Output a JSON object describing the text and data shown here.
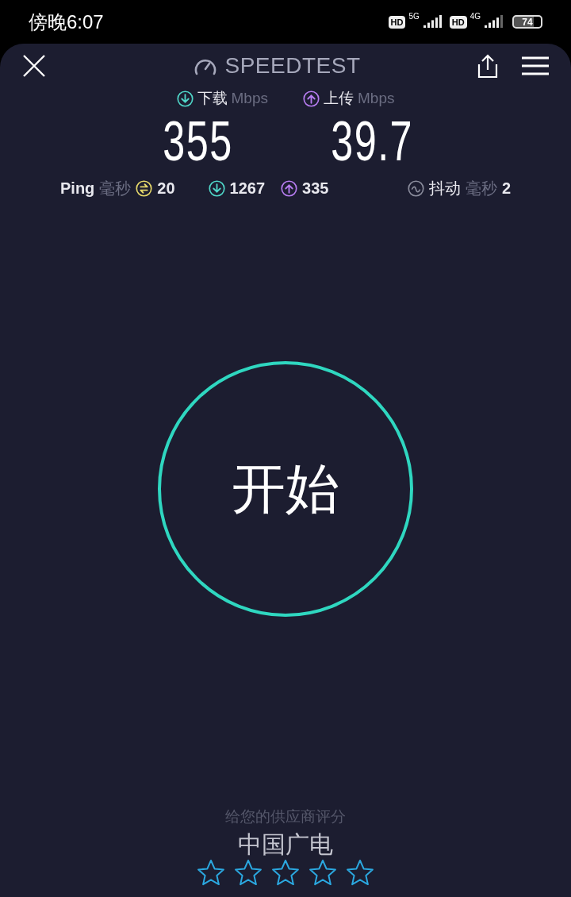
{
  "status_bar": {
    "time": "傍晚6:07",
    "networks": [
      {
        "badge": "HD",
        "type": "5G"
      },
      {
        "badge": "HD",
        "type": "4G"
      }
    ],
    "battery": "74"
  },
  "header": {
    "title": "SPEEDTEST"
  },
  "results": [
    {
      "kind": "download",
      "label": "下载",
      "unit": "Mbps",
      "value": "355"
    },
    {
      "kind": "upload",
      "label": "上传",
      "unit": "Mbps",
      "value": "39.7"
    }
  ],
  "stats": {
    "ping_label": "Ping",
    "ping_unit": "毫秒",
    "ping": "20",
    "download_latency": "1267",
    "upload_latency": "335",
    "jitter_label": "抖动",
    "jitter_unit": "毫秒",
    "jitter": "2"
  },
  "start_button": {
    "label": "开始"
  },
  "rating": {
    "prompt": "给您的供应商评分",
    "provider": "中国广电",
    "stars": 0
  }
}
